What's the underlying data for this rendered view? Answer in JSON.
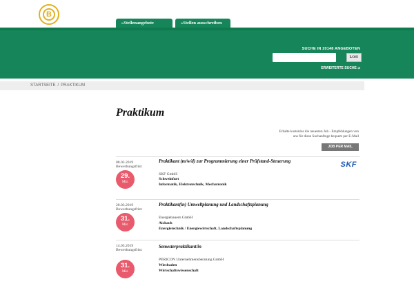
{
  "header": {
    "tabs": [
      "»Stellenangebote",
      "»Stellen ausschreiben"
    ]
  },
  "search": {
    "title": "SUCHE IN 20148 ANGEBOTEN",
    "button": "LOS!",
    "extended": "ERWEITERTE SUCHE",
    "placeholder": ""
  },
  "breadcrumb": {
    "home": "STARTSEITE",
    "current": "PRAKTIKUM"
  },
  "page": {
    "title": "Praktikum",
    "notice_line1": "Erhalte kostenlos die neuesten Job - Empfehlungen von",
    "notice_line2": "uns für diese Suchanfrage bequem per E-Mail",
    "job_mail_button": "JOB PER MAIL"
  },
  "jobs": [
    {
      "date": "08.03.2019",
      "deadline_label": "Bewerbungsfrist:",
      "deadline_day": "29.",
      "deadline_month": "Mär.",
      "title": "Praktikant (m/w/d) zur Programmierung einer Prüfstand-Steuerung",
      "company": "SKF GmbH",
      "city": "Schweinfurt",
      "field": "Informatik, Elektrotechnik, Mechatronik",
      "logo_text": "SKF"
    },
    {
      "date": "20.03.2019",
      "deadline_label": "Bewerbungsfrist:",
      "deadline_day": "31.",
      "deadline_month": "Mär.",
      "title": "Praktikant(in) Umweltplanung und Landschaftsplanung",
      "company": "Energiebauern GmbH",
      "city": "Aichach",
      "field": "Energietechnik / Energiewirtschaft, Landschaftsplanung"
    },
    {
      "date": "14.03.2019",
      "deadline_label": "Bewerbungsfrist:",
      "deadline_day": "31.",
      "deadline_month": "Mär.",
      "title": "Semesterpraktikant/in",
      "company": "PERICON Unternehmensberatung GmbH",
      "city": "Wiesbaden",
      "field": "Wirtschaftswissenschaft"
    }
  ],
  "colors": {
    "brand_green": "#16855a",
    "badge_red": "#e85a6c",
    "logo_gold": "#e0b020"
  }
}
